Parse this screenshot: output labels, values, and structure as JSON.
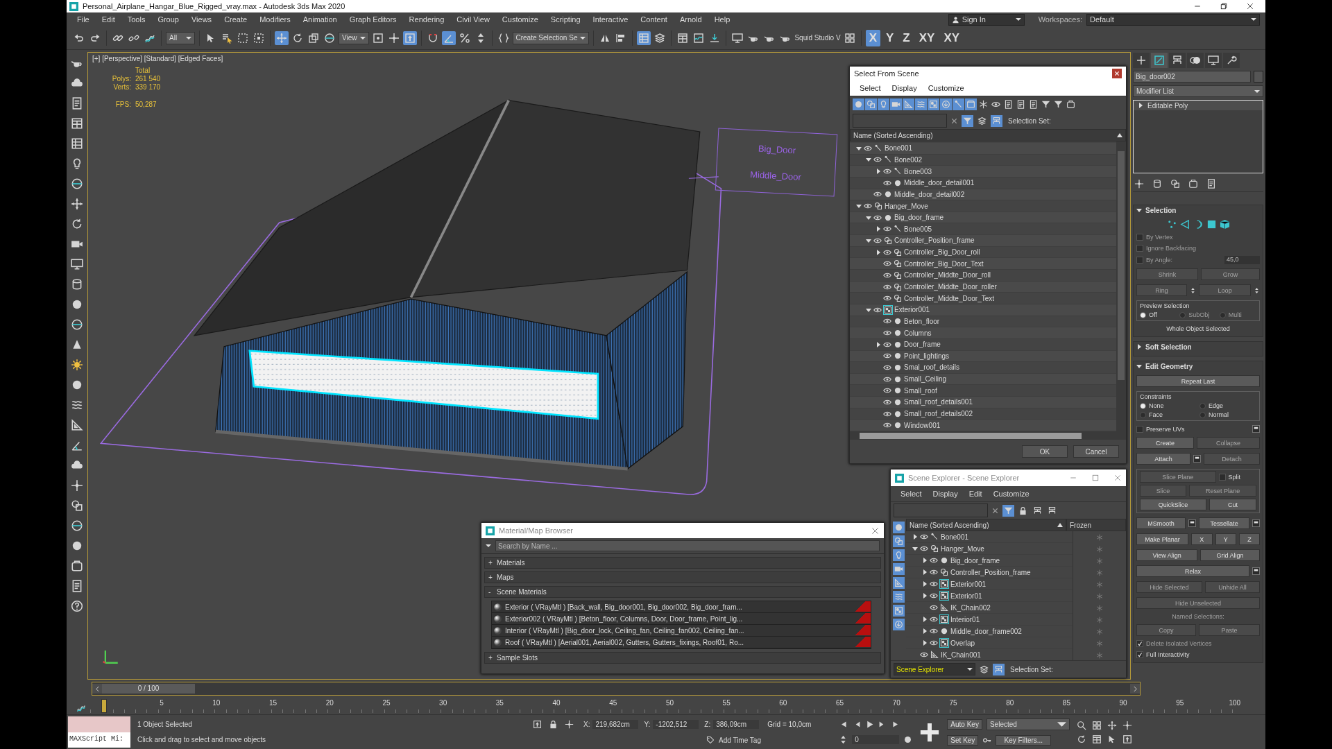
{
  "window": {
    "title": "Personal_Airplane_Hangar_Blue_Rigged_vray.max - Autodesk 3ds Max 2020"
  },
  "menu": [
    "File",
    "Edit",
    "Tools",
    "Group",
    "Views",
    "Create",
    "Modifiers",
    "Animation",
    "Graph Editors",
    "Rendering",
    "Civil View",
    "Customize",
    "Scripting",
    "Interactive",
    "Content",
    "Arnold",
    "Help"
  ],
  "account": {
    "sign_in": "Sign In",
    "workspaces_label": "Workspaces:",
    "workspace": "Default"
  },
  "toolbar": [
    {
      "kind": "tool",
      "selected": false
    },
    {
      "kind": "tool",
      "selected": false
    },
    {
      "kind": "sep"
    },
    {
      "kind": "tool",
      "selected": false
    },
    {
      "kind": "tool",
      "selected": false
    },
    {
      "kind": "tool",
      "selected": false
    },
    {
      "kind": "sep"
    },
    {
      "kind": "dropdown",
      "label": "All"
    },
    {
      "kind": "sep"
    },
    {
      "kind": "tool",
      "selected": false
    },
    {
      "kind": "tool",
      "selected": false
    },
    {
      "kind": "tool",
      "selected": false
    },
    {
      "kind": "tool",
      "selected": false
    },
    {
      "kind": "sep"
    },
    {
      "kind": "tool",
      "selected": true
    },
    {
      "kind": "tool",
      "selected": false
    },
    {
      "kind": "tool",
      "selected": false
    },
    {
      "kind": "tool",
      "selected": false
    },
    {
      "kind": "dropdown",
      "label": "View"
    },
    {
      "kind": "tool",
      "selected": false
    },
    {
      "kind": "tool",
      "selected": false
    },
    {
      "kind": "tool",
      "selected": true
    },
    {
      "kind": "sep"
    },
    {
      "kind": "tool",
      "selected": false
    },
    {
      "kind": "tool",
      "selected": true
    },
    {
      "kind": "tool",
      "selected": false
    },
    {
      "kind": "tool",
      "selected": false
    },
    {
      "kind": "sep"
    },
    {
      "kind": "tool",
      "selected": false
    },
    {
      "kind": "dropdown",
      "label": "Create Selection Se"
    },
    {
      "kind": "sep"
    },
    {
      "kind": "tool",
      "selected": false
    },
    {
      "kind": "tool",
      "selected": false
    },
    {
      "kind": "sep"
    },
    {
      "kind": "tool",
      "selected": true
    },
    {
      "kind": "tool",
      "selected": false
    },
    {
      "kind": "sep"
    },
    {
      "kind": "tool",
      "selected": false
    },
    {
      "kind": "tool",
      "selected": false
    },
    {
      "kind": "tool",
      "selected": false
    },
    {
      "kind": "sep"
    },
    {
      "kind": "tool",
      "selected": false
    },
    {
      "kind": "tool",
      "selected": false
    },
    {
      "kind": "tool",
      "selected": false
    },
    {
      "kind": "tool",
      "selected": false
    },
    {
      "kind": "text",
      "label": "Squid Studio V"
    },
    {
      "kind": "tool",
      "selected": false
    },
    {
      "kind": "sep"
    },
    {
      "kind": "axis",
      "label": "X",
      "selected": true
    },
    {
      "kind": "axis",
      "label": "Y",
      "selected": false
    },
    {
      "kind": "axis",
      "label": "Z",
      "selected": false
    },
    {
      "kind": "axis",
      "label": "XY",
      "selected": false
    },
    {
      "kind": "axis",
      "label": "XY",
      "selected": false
    }
  ],
  "viewport": {
    "label": "[+] [Perspective] [Standard] [Edged Faces]",
    "total": "Total",
    "polys_label": "Polys:",
    "polys": "261 540",
    "verts_label": "Verts:",
    "verts": "339 170",
    "fps_label": "FPS:",
    "fps": "50,287",
    "controllers": [
      "Big_Door",
      "Middle_Door"
    ]
  },
  "select_from_scene": {
    "title": "Select From Scene",
    "menu": [
      "Select",
      "Display",
      "Customize"
    ],
    "filters": [
      {
        "selected": true
      },
      {
        "selected": true
      },
      {
        "selected": true
      },
      {
        "selected": true
      },
      {
        "selected": true
      },
      {
        "selected": true
      },
      {
        "selected": true
      },
      {
        "selected": true
      },
      {
        "selected": true
      },
      {
        "selected": true
      },
      {
        "selected": false
      },
      {
        "selected": false
      },
      {
        "selected": false
      },
      {
        "selected": false
      },
      {
        "selected": false
      },
      {
        "selected": false
      },
      {
        "selected": false
      },
      {
        "selected": false
      }
    ],
    "selection_set_label": "Selection Set:",
    "column": "Name (Sorted Ascending)",
    "tree": [
      {
        "name": "Bone001",
        "kind": "bone",
        "expanded": true,
        "children": [
          {
            "name": "Bone002",
            "kind": "bone",
            "expanded": true,
            "children": [
              {
                "name": "Bone003",
                "kind": "bone",
                "expanded": false
              },
              {
                "name": "Middle_door_detail001",
                "kind": "geometry"
              }
            ]
          },
          {
            "name": "Middle_door_detail002",
            "kind": "geometry"
          }
        ]
      },
      {
        "name": "Hanger_Move",
        "kind": "group",
        "expanded": true,
        "children": [
          {
            "name": "Big_door_frame",
            "kind": "geometry",
            "expanded": true,
            "children": [
              {
                "name": "Bone005",
                "kind": "bone",
                "expanded": false
              }
            ]
          },
          {
            "name": "Controller_Position_frame",
            "kind": "group",
            "expanded": true,
            "children": [
              {
                "name": "Controller_Big_Door_roll",
                "kind": "group",
                "expanded": false
              },
              {
                "name": "Controller_Big_Door_Text",
                "kind": "group"
              },
              {
                "name": "Controller_Middte_Door_roll",
                "kind": "group"
              },
              {
                "name": "Controller_Middte_Door_roller",
                "kind": "group"
              },
              {
                "name": "Controller_Middte_Door_Text",
                "kind": "group"
              }
            ]
          },
          {
            "name": "Exterior001",
            "kind": "container",
            "expanded": true,
            "children": [
              {
                "name": "Beton_floor",
                "kind": "geometry"
              },
              {
                "name": "Columns",
                "kind": "geometry"
              },
              {
                "name": "Door_frame",
                "kind": "geometry",
                "expanded": false
              },
              {
                "name": "Point_lightings",
                "kind": "geometry"
              },
              {
                "name": "Smal_roof_details",
                "kind": "geometry"
              },
              {
                "name": "Small_Ceiling",
                "kind": "geometry"
              },
              {
                "name": "Small_roof",
                "kind": "geometry"
              },
              {
                "name": "Small_roof_details001",
                "kind": "geometry"
              },
              {
                "name": "Small_roof_details002",
                "kind": "geometry"
              },
              {
                "name": "Window001",
                "kind": "geometry"
              }
            ]
          }
        ]
      }
    ],
    "buttons": [
      "OK",
      "Cancel"
    ]
  },
  "scene_explorer": {
    "title": "Scene Explorer - Scene Explorer",
    "menu": [
      "Select",
      "Display",
      "Edit",
      "Customize"
    ],
    "filters": [
      {
        "selected": true
      },
      {
        "selected": true
      },
      {
        "selected": true
      },
      {
        "selected": true
      },
      {
        "selected": true
      },
      {
        "selected": true
      },
      {
        "selected": true
      },
      {
        "selected": true
      }
    ],
    "column": "Name (Sorted Ascending)",
    "frozen_column": "Frozen",
    "tree": [
      {
        "name": "Bone001",
        "kind": "bone",
        "expanded": false,
        "frozen": false
      },
      {
        "name": "Hanger_Move",
        "kind": "group",
        "expanded": true,
        "frozen": false,
        "children": [
          {
            "name": "Big_door_frame",
            "kind": "geometry",
            "expanded": false,
            "frozen": false
          },
          {
            "name": "Controller_Position_frame",
            "kind": "group",
            "expanded": false,
            "frozen": false
          },
          {
            "name": "Exterior001",
            "kind": "container",
            "expanded": false,
            "frozen": false
          },
          {
            "name": "Exterior01",
            "kind": "container",
            "expanded": false,
            "frozen": false
          },
          {
            "name": "IK_Chain002",
            "kind": "ikchain",
            "frozen": false
          },
          {
            "name": "Interior01",
            "kind": "container",
            "expanded": false,
            "frozen": false
          },
          {
            "name": "Middle_door_frame002",
            "kind": "geometry",
            "expanded": false,
            "frozen": false
          },
          {
            "name": "Overlap",
            "kind": "container",
            "expanded": false,
            "frozen": false
          }
        ]
      },
      {
        "name": "IK_Chain001",
        "kind": "ikchain",
        "frozen": false
      }
    ],
    "explorer": "Scene Explorer",
    "selection_set_label": "Selection Set:"
  },
  "material_browser": {
    "title": "Material/Map Browser",
    "search_placeholder": "Search by Name ...",
    "groups": [
      {
        "sign": "+",
        "label": "Materials"
      },
      {
        "sign": "+",
        "label": "Maps"
      },
      {
        "sign": "-",
        "label": "Scene Materials",
        "items": [
          "Exterior  ( VRayMtl ) [Back_wall, Big_door001, Big_door002, Big_door_fram...",
          "Exterior002  ( VRayMtl ) [Beton_floor, Columns, Door, Door_frame, Point_lig...",
          "Interior  ( VRayMtl ) [Big_door_lock, Ceiling_fan, Ceiling_fan002, Ceiling_fan...",
          "Roof  ( VRayMtl ) [Aerial001, Aerial002, Gutters, Gutters_fixings, Roof01, Ro..."
        ]
      },
      {
        "sign": "+",
        "label": "Sample Slots"
      }
    ]
  },
  "command_panel": {
    "tabs": [
      {
        "selected": false
      },
      {
        "selected": true
      },
      {
        "selected": false
      },
      {
        "selected": false
      },
      {
        "selected": false
      },
      {
        "selected": false
      }
    ],
    "object_name": "Big_door002",
    "modifier_list": "Modifier List",
    "stack": [
      {
        "label": "Editable Poly",
        "expanded": false
      }
    ],
    "rollouts": [
      {
        "title": "Selection",
        "expanded": true,
        "rows": [
          [
            {
              "kind": "icon",
              "selected": false
            },
            {
              "kind": "icon",
              "selected": false
            },
            {
              "kind": "icon",
              "selected": false
            },
            {
              "kind": "icon",
              "selected": false
            },
            {
              "kind": "icon",
              "selected": false
            }
          ],
          [
            {
              "kind": "check",
              "label": "By Vertex",
              "checked": false,
              "disabled": true
            }
          ],
          [
            {
              "kind": "check",
              "label": "Ignore Backfacing",
              "checked": false,
              "disabled": true
            }
          ],
          [
            {
              "kind": "check",
              "label": "By Angle:",
              "checked": false,
              "disabled": true
            },
            {
              "kind": "spinner",
              "value": "45,0",
              "disabled": true
            }
          ],
          [
            {
              "kind": "button",
              "label": "Shrink",
              "disabled": true
            },
            {
              "kind": "button",
              "label": "Grow",
              "disabled": true
            }
          ],
          [
            {
              "kind": "button",
              "label": "Ring",
              "disabled": true
            },
            {
              "kind": "updown"
            },
            {
              "kind": "button",
              "label": "Loop",
              "disabled": true
            },
            {
              "kind": "updown"
            }
          ],
          [
            {
              "kind": "group",
              "label": "Preview Selection",
              "rows": [
                [
                  {
                    "kind": "radio",
                    "label": "Off",
                    "selected": true,
                    "disabled": false
                  },
                  {
                    "kind": "radio",
                    "label": "SubObj",
                    "selected": false,
                    "disabled": true
                  },
                  {
                    "kind": "radio",
                    "label": "Multi",
                    "selected": false,
                    "disabled": true
                  }
                ]
              ]
            }
          ],
          [
            {
              "kind": "label",
              "label": "Whole Object Selected",
              "disabled": false
            }
          ]
        ]
      },
      {
        "title": "Soft Selection",
        "expanded": false
      },
      {
        "title": "Edit Geometry",
        "expanded": true,
        "rows": [
          [
            {
              "kind": "button",
              "label": "Repeat Last",
              "disabled": false
            }
          ],
          [
            {
              "kind": "group",
              "label": "Constraints",
              "rows": [
                [
                  {
                    "kind": "radio",
                    "label": "None",
                    "selected": true,
                    "disabled": false
                  },
                  {
                    "kind": "radio",
                    "label": "Edge",
                    "selected": false,
                    "disabled": false
                  }
                ],
                [
                  {
                    "kind": "radio",
                    "label": "Face",
                    "selected": false,
                    "disabled": false
                  },
                  {
                    "kind": "radio",
                    "label": "Normal",
                    "selected": false,
                    "disabled": false
                  }
                ]
              ]
            }
          ],
          [
            {
              "kind": "check",
              "label": "Preserve UVs",
              "checked": false,
              "disabled": false
            },
            {
              "kind": "settings"
            }
          ],
          [
            {
              "kind": "button",
              "label": "Create",
              "disabled": false
            },
            {
              "kind": "button",
              "label": "Collapse",
              "disabled": true
            }
          ],
          [
            {
              "kind": "button",
              "label": "Attach",
              "disabled": false
            },
            {
              "kind": "settings"
            },
            {
              "kind": "button",
              "label": "Detach",
              "disabled": true
            }
          ],
          [
            {
              "kind": "group",
              "rows": [
                [
                  {
                    "kind": "button",
                    "label": "Slice Plane",
                    "disabled": true
                  },
                  {
                    "kind": "check",
                    "label": "Split",
                    "checked": false,
                    "disabled": false
                  }
                ],
                [
                  {
                    "kind": "button",
                    "label": "Slice",
                    "disabled": true
                  },
                  {
                    "kind": "button",
                    "label": "Reset Plane",
                    "disabled": true
                  }
                ],
                [
                  {
                    "kind": "button",
                    "label": "QuickSlice",
                    "disabled": false
                  },
                  {
                    "kind": "button",
                    "label": "Cut",
                    "disabled": false
                  }
                ]
              ]
            }
          ],
          [
            {
              "kind": "button",
              "label": "MSmooth",
              "disabled": false
            },
            {
              "kind": "settings"
            },
            {
              "kind": "button",
              "label": "Tessellate",
              "disabled": false
            },
            {
              "kind": "settings"
            }
          ],
          [
            {
              "kind": "button",
              "label": "Make Planar",
              "disabled": false
            },
            {
              "kind": "button",
              "label": "X",
              "disabled": false
            },
            {
              "kind": "button",
              "label": "Y",
              "disabled": false
            },
            {
              "kind": "button",
              "label": "Z",
              "disabled": false
            }
          ],
          [
            {
              "kind": "button",
              "label": "View Align",
              "disabled": false
            },
            {
              "kind": "button",
              "label": "Grid Align",
              "disabled": false
            }
          ],
          [
            {
              "kind": "button",
              "label": "Relax",
              "disabled": false
            },
            {
              "kind": "settings"
            }
          ],
          [
            {
              "kind": "button",
              "label": "Hide Selected",
              "disabled": true
            },
            {
              "kind": "button",
              "label": "Unhide All",
              "disabled": true
            }
          ],
          [
            {
              "kind": "button",
              "label": "Hide Unselected",
              "disabled": true
            }
          ],
          [
            {
              "kind": "label",
              "label": "Named Selections:",
              "disabled": true
            }
          ],
          [
            {
              "kind": "button",
              "label": "Copy",
              "disabled": true
            },
            {
              "kind": "button",
              "label": "Paste",
              "disabled": true
            }
          ],
          [
            {
              "kind": "check",
              "label": "Delete Isolated Vertices",
              "checked": true,
              "disabled": true
            }
          ],
          [
            {
              "kind": "check",
              "label": "Full Interactivity",
              "checked": true,
              "disabled": false
            }
          ]
        ]
      }
    ]
  },
  "time_slider": {
    "label": "0 / 100",
    "level": 0
  },
  "ticks": [
    "5",
    "10",
    "15",
    "20",
    "25",
    "30",
    "35",
    "40",
    "45",
    "50",
    "55",
    "60",
    "65",
    "70",
    "75",
    "80",
    "85",
    "90",
    "95",
    "100"
  ],
  "status": {
    "maxscript": "MAXScript Mi:",
    "selection": "1 Object Selected",
    "prompt": "Click and drag to select and move objects",
    "coords": [
      {
        "axis": "X:",
        "value": "219,682cm"
      },
      {
        "axis": "Y:",
        "value": "-1202,512"
      },
      {
        "axis": "Z:",
        "value": "386,09cm"
      }
    ],
    "grid": "Grid = 10,0cm",
    "time_tag": "Add Time Tag",
    "auto_key": "Auto Key",
    "key_mode": "Selected",
    "set_key": "Set Key",
    "key_filters": "Key Filters...",
    "frame": "0"
  }
}
